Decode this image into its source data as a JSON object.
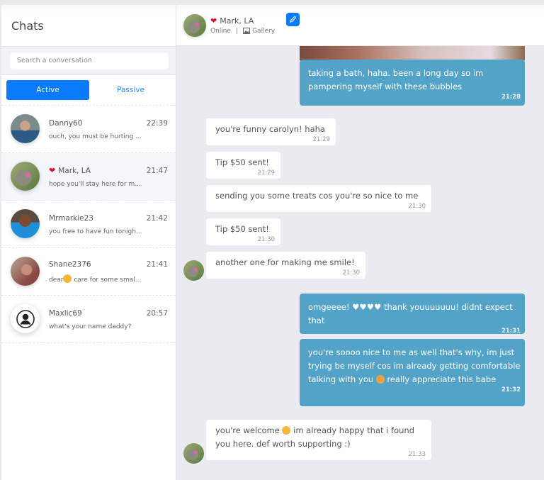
{
  "sidebar": {
    "title": "Chats",
    "search_placeholder": "Search a conversation",
    "tabs": [
      {
        "label": "Active",
        "active": true
      },
      {
        "label": "Passive",
        "active": false
      }
    ],
    "chats": [
      {
        "name": "Danny60",
        "time": "22:39",
        "preview": "ouch, you must be hurting ...",
        "heart": false
      },
      {
        "name": "Mark, LA",
        "time": "21:47",
        "preview": "hope you'll stay here for m...",
        "heart": true,
        "selected": true
      },
      {
        "name": "Mrmarkie23",
        "time": "21:42",
        "preview": "you free to have fun tonigh...",
        "heart": false
      },
      {
        "name": "Shane2376",
        "time": "21:41",
        "preview_before_emoji": "dear",
        "preview": "care for some smal...",
        "heart": false
      },
      {
        "name": "Maxlic69",
        "time": "20:57",
        "preview": "what's your name daddy?",
        "heart": false
      }
    ]
  },
  "conversation": {
    "contact_name": "Mark, LA",
    "status": "Online",
    "separator": "|",
    "gallery_label": "Gallery",
    "messages": [
      {
        "direction": "out",
        "text": "taking a bath, haha. been a long day so im pampering myself with these bubbles",
        "time": "21:28",
        "has_photo": true
      },
      {
        "direction": "in",
        "text": "you're funny carolyn! haha",
        "time": "21:29"
      },
      {
        "direction": "in",
        "text": "Tip $50 sent!",
        "time": "21:29"
      },
      {
        "direction": "in",
        "text": "sending you some treats cos you're so nice to me",
        "time": "21:30"
      },
      {
        "direction": "in",
        "text": "Tip $50 sent!",
        "time": "21:30"
      },
      {
        "direction": "in",
        "text": "another one for making me smile!",
        "time": "21:30"
      },
      {
        "direction": "out",
        "text": "omgeeee! ♥♥♥♥ thank youuuuuuu! didnt expect that",
        "time": "21:31"
      },
      {
        "direction": "out",
        "text_before_emoji": "you're soooo nice to me as well that's why, im just trying be myself cos im already getting comfortable talking with you",
        "text_after_emoji": "really appreciate this babe",
        "time": "21:32"
      },
      {
        "direction": "in",
        "text_before_emoji": "you're welcome",
        "text_after_emoji": "im already happy that i found you here. def worth supporting :)",
        "time": "21:33"
      }
    ]
  },
  "colors": {
    "accent": "#0a7bff",
    "outgoing_bubble": "#53a3c9",
    "incoming_bubble": "#ffffff",
    "chat_background": "#ebeaf1",
    "heart": "#d11a2a"
  }
}
